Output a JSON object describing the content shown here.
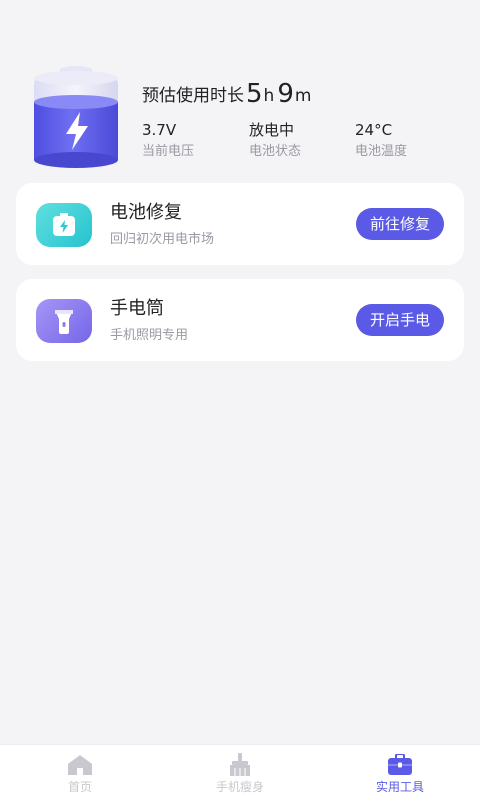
{
  "summary": {
    "estimate_label": "预估使用时长",
    "estimate_hours": "5",
    "estimate_hours_unit": "h",
    "estimate_minutes": "9",
    "estimate_minutes_unit": "m",
    "stats": [
      {
        "value": "3.7V",
        "label": "当前电压"
      },
      {
        "value": "放电中",
        "label": "电池状态"
      },
      {
        "value": "24°C",
        "label": "电池温度"
      }
    ],
    "battery_icon": "battery-charging-icon"
  },
  "cards": [
    {
      "title": "电池修复",
      "subtitle": "回归初次用电市场",
      "button": "前往修复",
      "icon": "battery-repair-icon"
    },
    {
      "title": "手电筒",
      "subtitle": "手机照明专用",
      "button": "开启手电",
      "icon": "flashlight-icon"
    }
  ],
  "nav": {
    "items": [
      {
        "label": "首页",
        "icon": "home-icon"
      },
      {
        "label": "手机瘦身",
        "icon": "broom-icon"
      },
      {
        "label": "实用工具",
        "icon": "toolbox-icon"
      }
    ]
  },
  "colors": {
    "accent": "#5a5ae6",
    "repair_icon_bg": "#3ad1d6",
    "flashlight_icon_bg": "#8a7cf0",
    "background": "#f4f4f6"
  }
}
